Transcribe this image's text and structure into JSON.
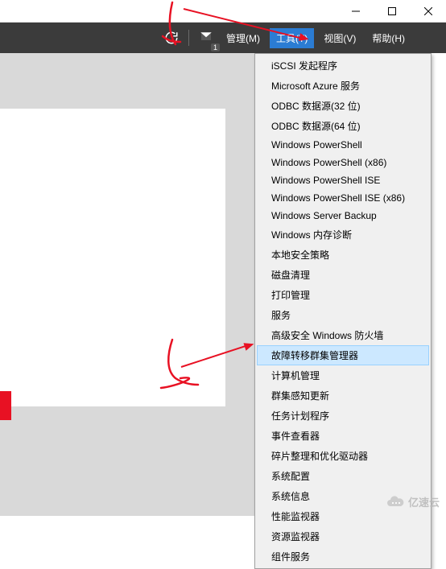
{
  "titlebar": {
    "minimize": "minimize",
    "maximize": "maximize",
    "close": "close"
  },
  "menubar": {
    "manage": "管理(M)",
    "tools": "工具(T)",
    "view": "视图(V)",
    "help": "帮助(H)"
  },
  "dropdown": {
    "items": [
      {
        "label": "iSCSI 发起程序",
        "highlight": false
      },
      {
        "label": "Microsoft Azure 服务",
        "highlight": false
      },
      {
        "label": "ODBC 数据源(32 位)",
        "highlight": false
      },
      {
        "label": "ODBC 数据源(64 位)",
        "highlight": false
      },
      {
        "label": "Windows PowerShell",
        "highlight": false
      },
      {
        "label": "Windows PowerShell (x86)",
        "highlight": false
      },
      {
        "label": "Windows PowerShell ISE",
        "highlight": false
      },
      {
        "label": "Windows PowerShell ISE (x86)",
        "highlight": false
      },
      {
        "label": "Windows Server Backup",
        "highlight": false
      },
      {
        "label": "Windows 内存诊断",
        "highlight": false
      },
      {
        "label": "本地安全策略",
        "highlight": false
      },
      {
        "label": "磁盘清理",
        "highlight": false
      },
      {
        "label": "打印管理",
        "highlight": false
      },
      {
        "label": "服务",
        "highlight": false
      },
      {
        "label": "高级安全 Windows 防火墙",
        "highlight": false
      },
      {
        "label": "故障转移群集管理器",
        "highlight": true
      },
      {
        "label": "计算机管理",
        "highlight": false
      },
      {
        "label": "群集感知更新",
        "highlight": false
      },
      {
        "label": "任务计划程序",
        "highlight": false
      },
      {
        "label": "事件查看器",
        "highlight": false
      },
      {
        "label": "碎片整理和优化驱动器",
        "highlight": false
      },
      {
        "label": "系统配置",
        "highlight": false
      },
      {
        "label": "系统信息",
        "highlight": false
      },
      {
        "label": "性能监视器",
        "highlight": false
      },
      {
        "label": "资源监视器",
        "highlight": false
      },
      {
        "label": "组件服务",
        "highlight": false
      }
    ]
  },
  "notif_badge": "1",
  "watermark": "亿速云"
}
